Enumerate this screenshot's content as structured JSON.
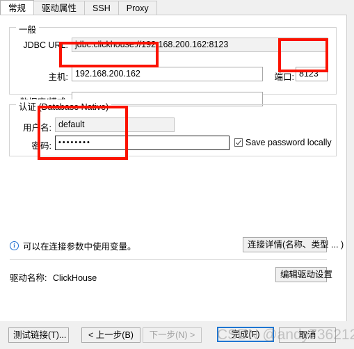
{
  "window": {
    "watermark": "CSDN @andy736212"
  },
  "tabs": [
    {
      "label": "常规",
      "active": true
    },
    {
      "label": "驱动属性",
      "active": false
    },
    {
      "label": "SSH",
      "active": false
    },
    {
      "label": "Proxy",
      "active": false
    }
  ],
  "general": {
    "group_title": "一般",
    "jdbc_url_label": "JDBC URL:",
    "jdbc_url_value": "jdbc:clickhouse://192.168.200.162:8123",
    "host_label": "主机:",
    "host_value": "192.168.200.162",
    "port_label": "端口:",
    "port_value": "8123",
    "database_label": "数据库/模式:",
    "database_value": ""
  },
  "auth": {
    "group_title": "认证 (Database Native)",
    "username_label": "用户名:",
    "username_value": "default",
    "password_label": "密码:",
    "password_value": "••••••••",
    "save_password_label": "Save password locally"
  },
  "footer": {
    "info_icon": "info-icon",
    "info_text": "可以在连接参数中使用变量。",
    "connection_details_label": "连接详情(名称、类型 ... )",
    "driver_name_label": "驱动名称:",
    "driver_name_value": "ClickHouse",
    "edit_driver_label": "编辑驱动设置"
  },
  "buttons": {
    "test_connection": "测试链接(T)...",
    "back": "< 上一步(B)",
    "next": "下一步(N) >",
    "finish": "完成(F)",
    "cancel": "取消"
  },
  "annotations": {
    "colour": "#fb1200",
    "boxes": [
      {
        "name": "host-highlight"
      },
      {
        "name": "port-highlight"
      },
      {
        "name": "credentials-highlight"
      }
    ]
  }
}
